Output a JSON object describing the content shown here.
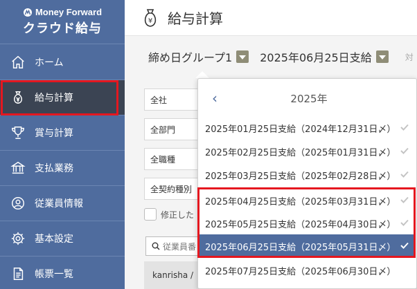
{
  "brand": {
    "line1": "Money Forward",
    "line2": "クラウド給与"
  },
  "sidebar": {
    "items": [
      {
        "label": "ホーム",
        "icon": "home-icon"
      },
      {
        "label": "給与計算",
        "icon": "money-bag-icon",
        "active": true
      },
      {
        "label": "賞与計算",
        "icon": "trophy-icon"
      },
      {
        "label": "支払業務",
        "icon": "bank-icon"
      },
      {
        "label": "従業員情報",
        "icon": "user-icon"
      },
      {
        "label": "基本設定",
        "icon": "gear-icon"
      },
      {
        "label": "帳票一覧",
        "icon": "document-icon"
      }
    ]
  },
  "header": {
    "title": "給与計算",
    "icon": "money-bag-icon"
  },
  "group_bar": {
    "group_label": "締め日グループ1",
    "payday_label": "2025年06月25日支給",
    "extra": "対"
  },
  "filters": [
    "全社",
    "全部門",
    "全職種",
    "全契約種別"
  ],
  "checkbox_label": "修正した",
  "search": {
    "placeholder": "従業員番"
  },
  "table_first_cell": "kanrisha /",
  "dropdown": {
    "year": "2025年",
    "items": [
      {
        "label": "2025年01月25日支給（2024年12月31日〆）",
        "checked": true
      },
      {
        "label": "2025年02月25日支給（2025年01月31日〆）",
        "checked": true
      },
      {
        "label": "2025年03月25日支給（2025年02月28日〆）",
        "checked": true
      },
      {
        "label": "2025年04月25日支給（2025年03月31日〆）",
        "checked": true
      },
      {
        "label": "2025年05月25日支給（2025年04月30日〆）",
        "checked": true
      },
      {
        "label": "2025年06月25日支給（2025年05月31日〆）",
        "checked": true,
        "selected": true
      },
      {
        "label": "2025年07月25日支給（2025年06月30日〆）",
        "checked": false
      }
    ]
  },
  "colors": {
    "sidebar": "#4f6c9e",
    "sidebar_active": "#3b4453",
    "highlight": "#e5171f",
    "caret_button": "#8f8d77"
  }
}
